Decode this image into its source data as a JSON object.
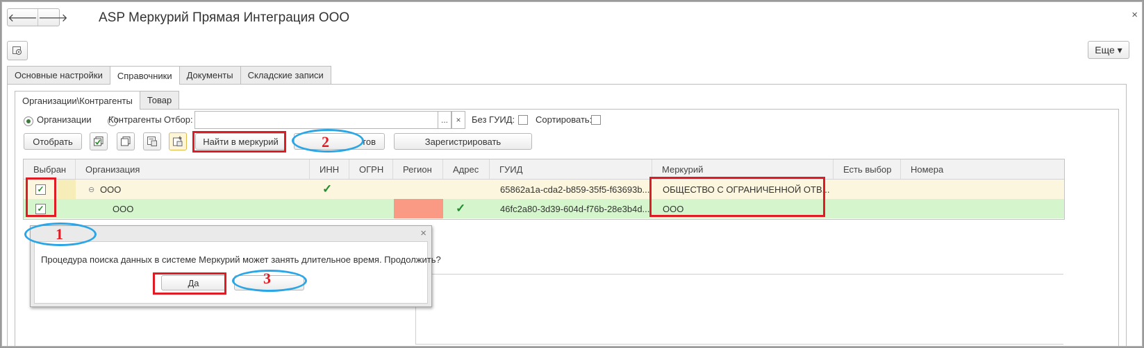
{
  "window": {
    "title": "ASP Меркурий Прямая Интеграция ООО",
    "close_label": "×"
  },
  "nav": {
    "back": "🡐",
    "forward": "🡒"
  },
  "more_button": {
    "label": "Еще ▾"
  },
  "main_tabs": [
    {
      "label": "Основные настройки"
    },
    {
      "label": "Справочники"
    },
    {
      "label": "Документы"
    },
    {
      "label": "Складские записи"
    }
  ],
  "sub_tabs": [
    {
      "label": "Организации\\Контрагенты"
    },
    {
      "label": "Товар"
    }
  ],
  "filter": {
    "radio_org": "Организации",
    "radio_contr": "Контрагенты",
    "filter_label": "Отбор:",
    "filter_value": "",
    "dots": "...",
    "clear": "×",
    "no_guid_label": "Без ГУИД:",
    "sort_label": "Сортировать:"
  },
  "toolbar": {
    "select_label": "Отобрать",
    "find_label": "Найти в меркурий",
    "hidden_label": "тов",
    "register_label": "Зарегистрировать"
  },
  "table": {
    "headers": [
      "Выбран",
      "Организация",
      "ИНН",
      "ОГРН",
      "Регион",
      "Адрес",
      "ГУИД",
      "Меркурий",
      "Есть выбор",
      "Номера"
    ],
    "rows": [
      {
        "org": "ООО",
        "guid": "65862a1a-cda2-b859-35f5-f63693b...",
        "mercury": "ОБЩЕСТВО С ОГРАНИЧЕННОЙ ОТВ..."
      },
      {
        "org": "ООО",
        "guid": "46fc2a80-3d39-604d-f76b-28e3b4d...",
        "mercury": "ООО"
      }
    ]
  },
  "dialog": {
    "close": "×",
    "message": "Процедура поиска данных в системе Меркурий может занять длительное время. Продолжить?",
    "yes_label": "Да"
  },
  "annotations": {
    "n1": "1",
    "n2": "2",
    "n3": "3",
    "red": "#e01b24",
    "blue": "#2aa6e6"
  },
  "colors": {
    "row_selected": "#fbf6dd",
    "row_green": "#d5f5cd",
    "region_red": "#fa9a84"
  }
}
